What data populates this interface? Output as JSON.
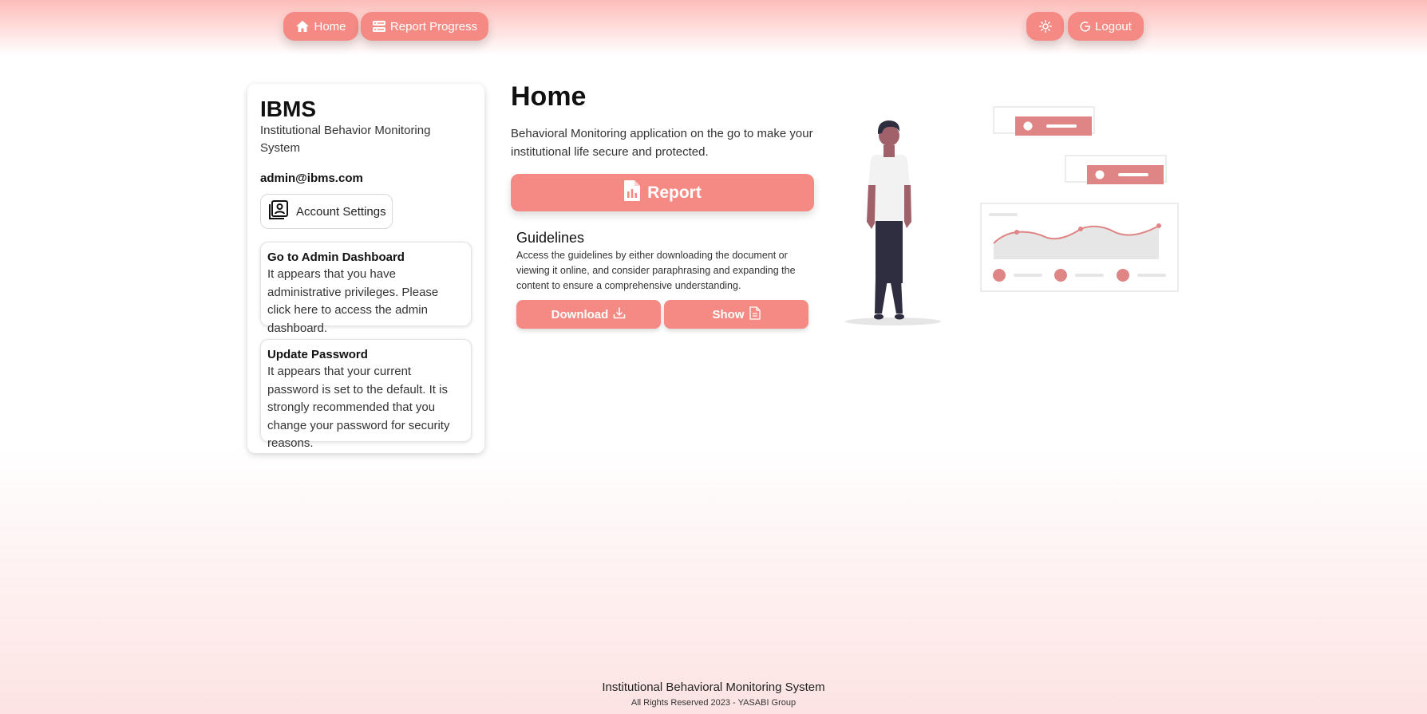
{
  "nav": {
    "home_label": "Home",
    "report_progress_label": "Report Progress",
    "logout_label": "Logout",
    "theme_toggle_icon": "sun-icon"
  },
  "sidebar": {
    "brand": "IBMS",
    "brand_subtitle": "Institutional Behavior Monitoring System",
    "email": "admin@ibms.com",
    "account_settings_label": "Account Settings",
    "admin_notice": {
      "title": "Go to Admin Dashboard",
      "body": "It appears that you have administrative privileges. Please click here to access the admin dashboard."
    },
    "password_notice": {
      "title": "Update Password",
      "body": "It appears that your current password is set to the default. It is strongly recommended that you change your password for security reasons."
    }
  },
  "main": {
    "title": "Home",
    "description": "Behavioral Monitoring application on the go to make your institutional life secure and protected.",
    "report_label": "Report",
    "guidelines": {
      "title": "Guidelines",
      "body": "Access the guidelines by either downloading the document or viewing it online, and consider paraphrasing and expanding the content to ensure a comprehensive understanding.",
      "download_label": "Download",
      "show_label": "Show"
    }
  },
  "footer": {
    "title": "Institutional Behavioral Monitoring System",
    "copyright": "All Rights Reserved 2023 - YASABI Group"
  },
  "colors": {
    "accent": "#f58a84",
    "illustration_accent": "#e08585"
  }
}
